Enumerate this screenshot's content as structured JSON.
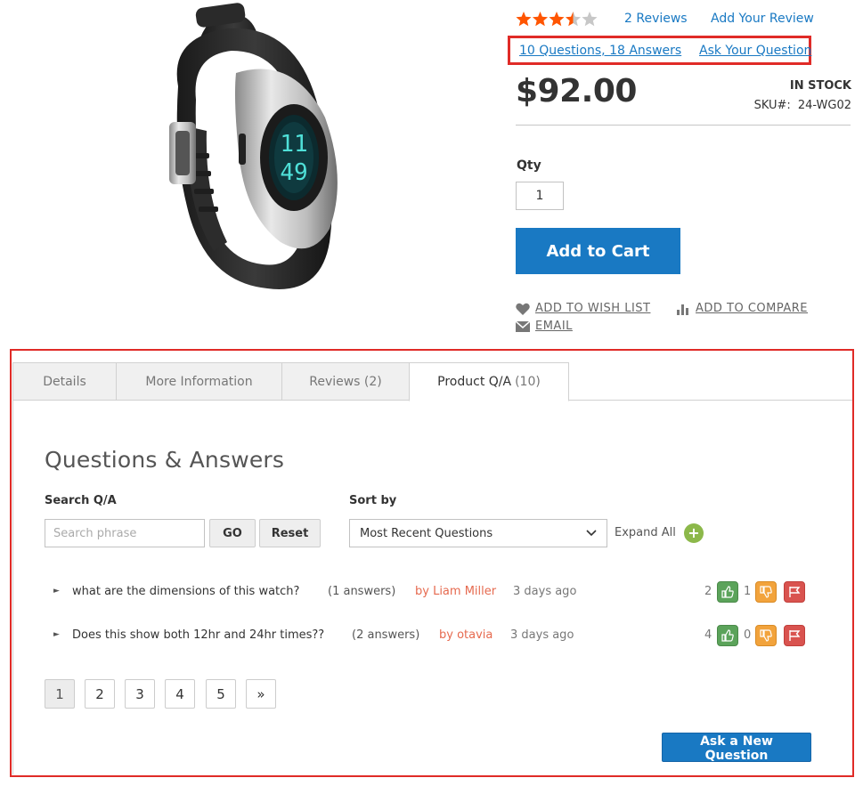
{
  "product": {
    "rating": 3.5,
    "rating_max": 5,
    "reviews_link": "2 Reviews",
    "add_review_link": "Add Your Review",
    "qa_summary": "10 Questions, 18 Answers",
    "ask_question_link": "Ask Your Question",
    "price": "$92.00",
    "stock_status": "IN STOCK",
    "sku_label": "SKU#:",
    "sku_value": "24-WG02",
    "qty_label": "Qty",
    "qty_value": "1",
    "add_to_cart": "Add to Cart",
    "wishlist": "ADD TO WISH LIST",
    "compare": "ADD TO COMPARE",
    "email": "EMAIL",
    "watch_display_top": "11",
    "watch_display_bottom": "49"
  },
  "tabs": {
    "details": "Details",
    "more_info": "More Information",
    "reviews": "Reviews (2)",
    "qa_label": "Product Q/A",
    "qa_count": "(10)"
  },
  "qa": {
    "heading": "Questions & Answers",
    "search_label": "Search Q/A",
    "search_placeholder": "Search phrase",
    "go": "GO",
    "reset": "Reset",
    "sort_label": "Sort by",
    "sort_selected": "Most Recent Questions",
    "expand_all": "Expand All",
    "expand_all_icon": "+",
    "questions": [
      {
        "text": "what are the dimensions of this watch?",
        "answers": "(1 answers)",
        "author": "by Liam Miller",
        "time": "3 days ago",
        "up": "2",
        "down": "1"
      },
      {
        "text": "Does this show both 12hr and 24hr times??",
        "answers": "(2 answers)",
        "author": "by otavia",
        "time": "3 days ago",
        "up": "4",
        "down": "0"
      }
    ],
    "pages": [
      "1",
      "2",
      "3",
      "4",
      "5",
      "»"
    ],
    "current_page": "1",
    "ask_new": "Ask a New Question"
  },
  "colors": {
    "accent": "#1979c3",
    "highlight_border": "#e02b27",
    "star_filled": "#ff5501",
    "star_empty": "#c7c7c7",
    "vote_up": "#5ba35a",
    "vote_down": "#f2a33c",
    "flag": "#d9534f",
    "author": "#e66a4f",
    "expand": "#8cb84a"
  },
  "icons": {
    "wishlist": "heart-icon",
    "compare": "bar-chart-icon",
    "email": "envelope-icon",
    "vote_up": "thumbs-up-icon",
    "vote_down": "thumbs-down-icon",
    "flag": "flag-icon",
    "row_toggle": "triangle-right-icon",
    "sort_dropdown": "chevron-down-icon"
  }
}
